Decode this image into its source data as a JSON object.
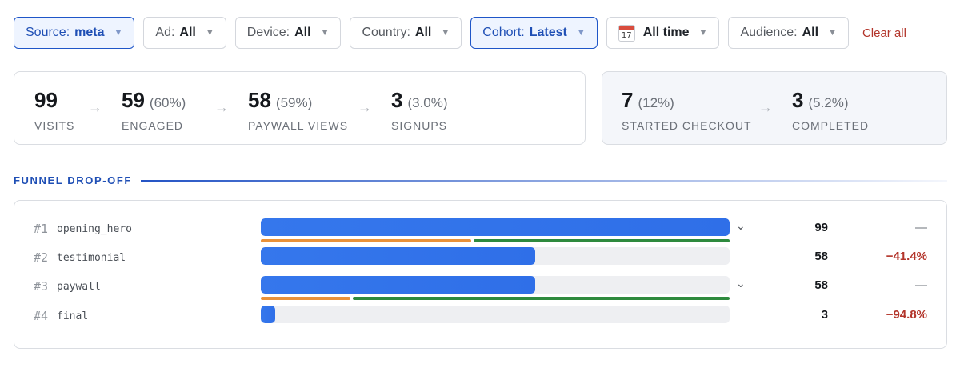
{
  "filters": [
    {
      "label": "Source:",
      "value": "meta",
      "active": true
    },
    {
      "label": "Ad:",
      "value": "All",
      "active": false
    },
    {
      "label": "Device:",
      "value": "All",
      "active": false
    },
    {
      "label": "Country:",
      "value": "All",
      "active": false
    },
    {
      "label": "Cohort:",
      "value": "Latest",
      "active": true
    },
    {
      "label": "",
      "value": "All time",
      "active": false,
      "icon": "calendar-icon",
      "icon_day": "17"
    },
    {
      "label": "Audience:",
      "value": "All",
      "active": false
    }
  ],
  "caret": "▼",
  "clear_all": "Clear all",
  "stats_main": [
    {
      "value": "99",
      "pct": "",
      "label": "VISITS"
    },
    {
      "value": "59",
      "pct": "(60%)",
      "label": "ENGAGED"
    },
    {
      "value": "58",
      "pct": "(59%)",
      "label": "PAYWALL VIEWS"
    },
    {
      "value": "3",
      "pct": "(3.0%)",
      "label": "SIGNUPS"
    }
  ],
  "stats_checkout": [
    {
      "value": "7",
      "pct": "(12%)",
      "label": "STARTED CHECKOUT"
    },
    {
      "value": "3",
      "pct": "(5.2%)",
      "label": "COMPLETED"
    }
  ],
  "arrow_glyph": "→",
  "section_title": "FUNNEL DROP-OFF",
  "funnel": {
    "max": 99,
    "rows": [
      {
        "index": "#1",
        "name": "opening_hero",
        "count": "99",
        "value": 99,
        "delta": "—",
        "expandable": true,
        "split": {
          "orange": 0.45,
          "green": 0.55
        }
      },
      {
        "index": "#2",
        "name": "testimonial",
        "count": "58",
        "value": 58,
        "delta": "−41.4%",
        "expandable": false
      },
      {
        "index": "#3",
        "name": "paywall",
        "count": "58",
        "value": 58,
        "delta": "—",
        "expandable": true,
        "split": {
          "orange": 0.33,
          "green": 0.67
        }
      },
      {
        "index": "#4",
        "name": "final",
        "count": "3",
        "value": 3,
        "delta": "−94.8%",
        "expandable": false
      }
    ],
    "chevron": "⌄"
  },
  "colors": {
    "accent": "#1f4fb5",
    "bar": "#3577ec",
    "orange": "#e9923a",
    "green": "#2e8a3e",
    "negative": "#b3352b"
  }
}
